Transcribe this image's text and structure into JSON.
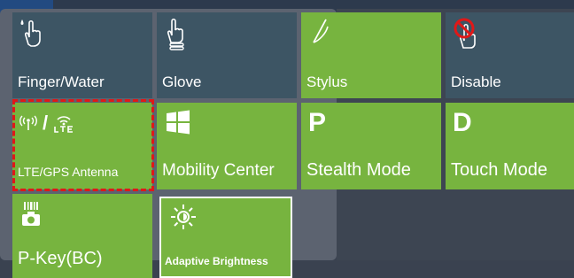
{
  "tiles": {
    "finger_water": {
      "label": "Finger/Water",
      "icon": "finger-water-icon"
    },
    "glove": {
      "label": "Glove",
      "icon": "glove-icon"
    },
    "stylus": {
      "label": "Stylus",
      "icon": "stylus-icon"
    },
    "disable": {
      "label": "Disable",
      "icon": "disable-touch-icon"
    },
    "lte": {
      "label": "LTE/GPS Antenna",
      "icon_text": "/",
      "icon": "lte-antenna-icon"
    },
    "mobility": {
      "label": "Mobility Center",
      "icon": "windows-icon"
    },
    "stealth": {
      "label": "Stealth Mode",
      "letter": "P"
    },
    "touch": {
      "label": "Touch Mode",
      "letter": "D"
    },
    "pkey": {
      "label": "P-Key(BC)",
      "icon": "barcode-camera-icon"
    },
    "brightness": {
      "label": "Adaptive Brightness",
      "icon": "sun-icon"
    }
  },
  "colors": {
    "active_tile": "#77b43f",
    "inactive_tile": "#3d5564",
    "selection_outline": "#e01818"
  }
}
